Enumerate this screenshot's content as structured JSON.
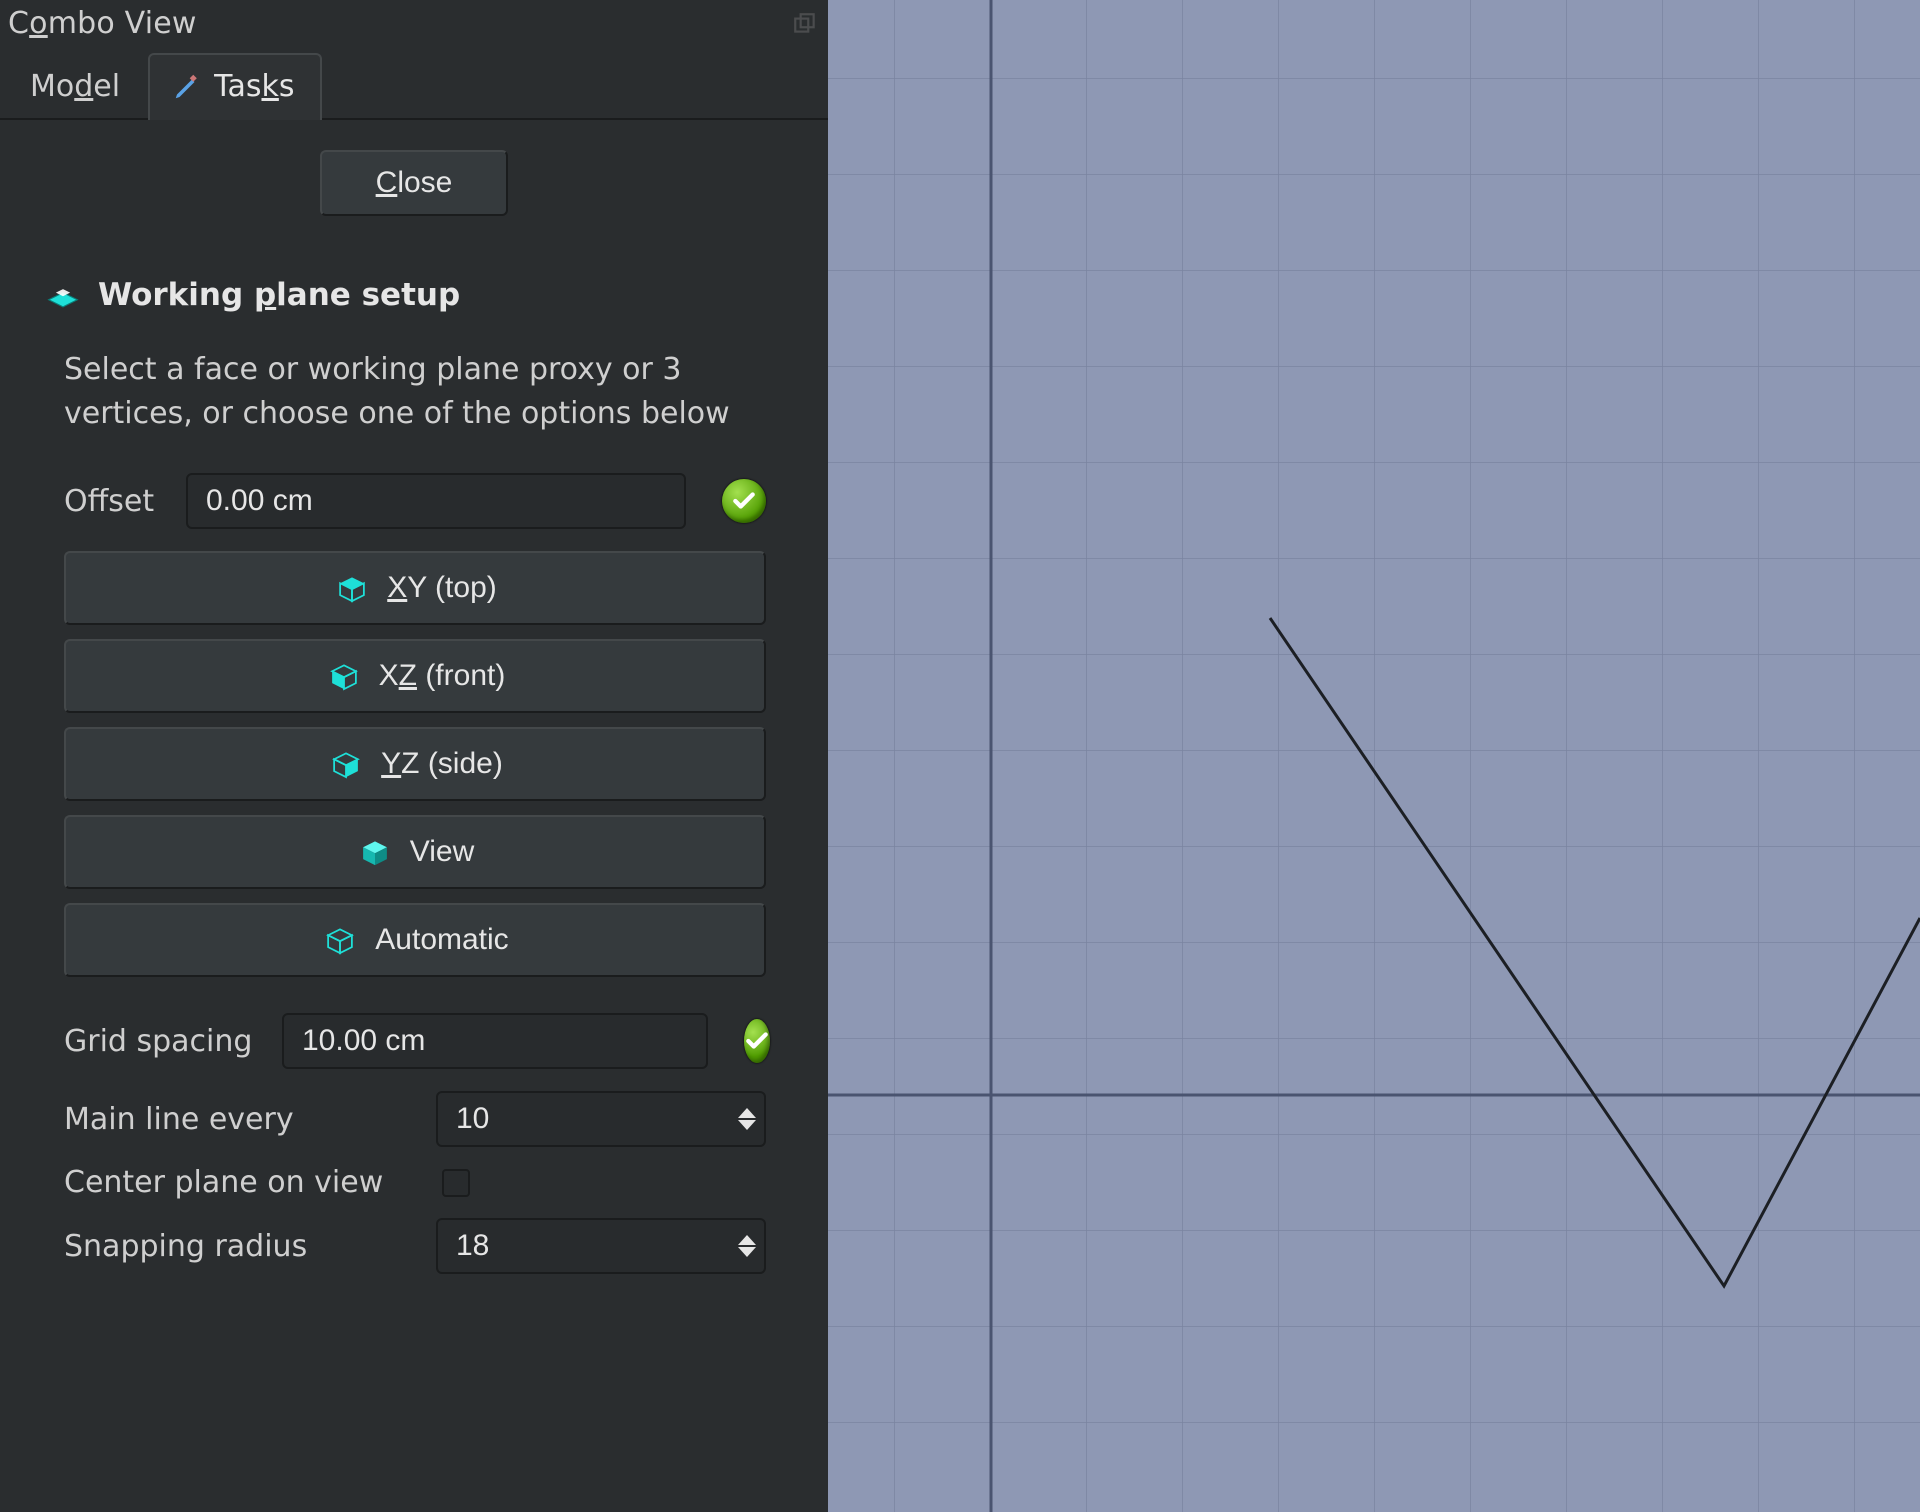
{
  "panel": {
    "title_pre": "C",
    "title_u": "o",
    "title_post": "mbo View"
  },
  "tabs": {
    "model_pre": "Mo",
    "model_u": "d",
    "model_post": "el",
    "tasks_pre": "Tas",
    "tasks_u": "k",
    "tasks_post": "s"
  },
  "buttons": {
    "close_u": "C",
    "close_post": "lose"
  },
  "section": {
    "title_pre": "Working ",
    "title_u": "p",
    "title_post": "lane setup",
    "description": "Select a face or working plane proxy or 3 vertices, or choose one of the options below"
  },
  "offset": {
    "label": "Offset",
    "value": "0.00 cm"
  },
  "planes": {
    "xy_u": "X",
    "xy_post": "Y (top)",
    "xz_pre": "X",
    "xz_u": "Z",
    "xz_post": " (front)",
    "yz_u": "Y",
    "yz_post": "Z (side)",
    "view": "View",
    "auto": "Automatic"
  },
  "grid": {
    "spacing_label": "Grid spacing",
    "spacing_value": "10.00 cm",
    "mainline_label": "Main line every",
    "mainline_value": "10",
    "center_label": "Center plane on view",
    "snap_label": "Snapping radius",
    "snap_value": "18"
  },
  "colors": {
    "cyan": "#1ee0d8"
  }
}
